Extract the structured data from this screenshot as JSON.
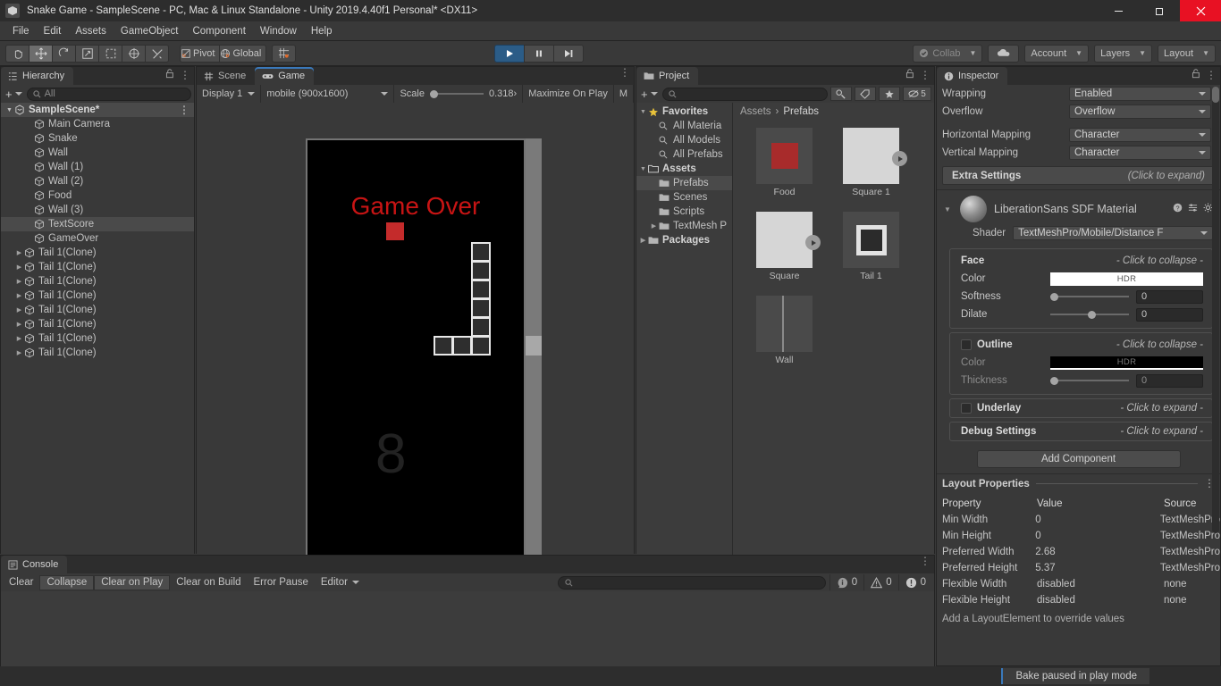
{
  "window": {
    "title": "Snake Game - SampleScene - PC, Mac & Linux Standalone - Unity 2019.4.40f1 Personal* <DX11>",
    "minimize": "minimize-icon",
    "maximize": "maximize-icon",
    "close": "close-icon"
  },
  "menubar": {
    "items": [
      "File",
      "Edit",
      "Assets",
      "GameObject",
      "Component",
      "Window",
      "Help"
    ]
  },
  "toolbar": {
    "tools": [
      {
        "name": "hand-tool",
        "icon": "hand-icon",
        "selected": false
      },
      {
        "name": "move-tool",
        "icon": "move-icon",
        "selected": true
      },
      {
        "name": "rotate-tool",
        "icon": "rotate-icon",
        "selected": false
      },
      {
        "name": "scale-tool",
        "icon": "scale-icon",
        "selected": false
      },
      {
        "name": "rect-tool",
        "icon": "rect-icon",
        "selected": false
      },
      {
        "name": "transform-tool",
        "icon": "transform-icon",
        "selected": false
      },
      {
        "name": "custom-tool",
        "icon": "wrench-icon",
        "selected": false
      }
    ],
    "pivot_label": "Pivot",
    "global_label": "Global",
    "grid_snap": "grid-snap-icon",
    "play": "play-icon",
    "pause": "pause-icon",
    "step": "step-icon",
    "collab_label": "Collab",
    "cloud_label": "cloud-icon",
    "account_label": "Account",
    "layers_label": "Layers",
    "layout_label": "Layout"
  },
  "hierarchy": {
    "tab_label": "Hierarchy",
    "search_placeholder": "All",
    "plus_label": "+",
    "items": [
      {
        "label": "SampleScene*",
        "depth": 0,
        "type": "scene",
        "expandable": true,
        "selected": false
      },
      {
        "label": "Main Camera",
        "depth": 2,
        "type": "go",
        "expandable": false,
        "selected": false
      },
      {
        "label": "Snake",
        "depth": 2,
        "type": "go",
        "expandable": false,
        "selected": false
      },
      {
        "label": "Wall",
        "depth": 2,
        "type": "go",
        "expandable": false,
        "selected": false
      },
      {
        "label": "Wall (1)",
        "depth": 2,
        "type": "go",
        "expandable": false,
        "selected": false
      },
      {
        "label": "Wall (2)",
        "depth": 2,
        "type": "go",
        "expandable": false,
        "selected": false
      },
      {
        "label": "Food",
        "depth": 2,
        "type": "go",
        "expandable": false,
        "selected": false
      },
      {
        "label": "Wall (3)",
        "depth": 2,
        "type": "go",
        "expandable": false,
        "selected": false
      },
      {
        "label": "TextScore",
        "depth": 2,
        "type": "go",
        "expandable": false,
        "selected": true
      },
      {
        "label": "GameOver",
        "depth": 2,
        "type": "go",
        "expandable": false,
        "selected": false
      },
      {
        "label": "Tail 1(Clone)",
        "depth": 1,
        "type": "go",
        "expandable": true,
        "selected": false
      },
      {
        "label": "Tail 1(Clone)",
        "depth": 1,
        "type": "go",
        "expandable": true,
        "selected": false
      },
      {
        "label": "Tail 1(Clone)",
        "depth": 1,
        "type": "go",
        "expandable": true,
        "selected": false
      },
      {
        "label": "Tail 1(Clone)",
        "depth": 1,
        "type": "go",
        "expandable": true,
        "selected": false
      },
      {
        "label": "Tail 1(Clone)",
        "depth": 1,
        "type": "go",
        "expandable": true,
        "selected": false
      },
      {
        "label": "Tail 1(Clone)",
        "depth": 1,
        "type": "go",
        "expandable": true,
        "selected": false
      },
      {
        "label": "Tail 1(Clone)",
        "depth": 1,
        "type": "go",
        "expandable": true,
        "selected": false
      },
      {
        "label": "Tail 1(Clone)",
        "depth": 1,
        "type": "go",
        "expandable": true,
        "selected": false
      }
    ]
  },
  "gameview": {
    "scene_tab": "Scene",
    "game_tab": "Game",
    "display": "Display 1",
    "resolution": "mobile (900x1600)",
    "scale_label": "Scale",
    "scale_value": "0.318›",
    "maximize_on_play": "Maximize On Play",
    "mute_partial": "M",
    "game_over_text": "Game Over",
    "score_text": "8",
    "colors": {
      "game_over": "#c81414",
      "food": "#c42b2b",
      "background": "#000000",
      "wall": "#747474",
      "segment_border": "#e8e8e8"
    }
  },
  "project": {
    "tab_label": "Project",
    "search_placeholder": "",
    "hidden_count": "5",
    "tree": [
      {
        "label": "Favorites",
        "depth": 0,
        "icon": "star-icon",
        "expandable": true,
        "selected": false
      },
      {
        "label": "All Materia",
        "depth": 1,
        "icon": "search-icon",
        "expandable": false,
        "selected": false
      },
      {
        "label": "All Models",
        "depth": 1,
        "icon": "search-icon",
        "expandable": false,
        "selected": false
      },
      {
        "label": "All Prefabs",
        "depth": 1,
        "icon": "search-icon",
        "expandable": false,
        "selected": false
      },
      {
        "label": "Assets",
        "depth": 0,
        "icon": "folder-open-icon",
        "expandable": true,
        "selected": false
      },
      {
        "label": "Prefabs",
        "depth": 1,
        "icon": "folder-icon",
        "expandable": false,
        "selected": true
      },
      {
        "label": "Scenes",
        "depth": 1,
        "icon": "folder-icon",
        "expandable": false,
        "selected": false
      },
      {
        "label": "Scripts",
        "depth": 1,
        "icon": "folder-icon",
        "expandable": false,
        "selected": false
      },
      {
        "label": "TextMesh P",
        "depth": 1,
        "icon": "folder-icon",
        "expandable": true,
        "selected": false
      },
      {
        "label": "Packages",
        "depth": 0,
        "icon": "folder-icon",
        "expandable": true,
        "selected": false
      }
    ],
    "breadcrumb": [
      "Assets",
      "Prefabs"
    ],
    "assets": [
      {
        "name": "Food",
        "kind": "sprite",
        "color": "#a82b2b",
        "has_prefab_arrow": false
      },
      {
        "name": "Square 1",
        "kind": "sprite",
        "color": "#d6d6d6",
        "has_prefab_arrow": true
      },
      {
        "name": "Square",
        "kind": "sprite",
        "color": "#d6d6d6",
        "has_prefab_arrow": true
      },
      {
        "name": "Tail 1",
        "kind": "outline",
        "color": "#e2e2e2",
        "has_prefab_arrow": false
      },
      {
        "name": "Wall",
        "kind": "wall",
        "color": "#4a4a4a",
        "has_prefab_arrow": false
      }
    ]
  },
  "inspector": {
    "tab_label": "Inspector",
    "text_settings": [
      {
        "label": "Wrapping",
        "value": "Enabled"
      },
      {
        "label": "Overflow",
        "value": "Overflow"
      },
      {
        "label": "Horizontal Mapping",
        "value": "Character"
      },
      {
        "label": "Vertical Mapping",
        "value": "Character"
      }
    ],
    "extra_settings": {
      "label": "Extra Settings",
      "hint": "(Click to expand)"
    },
    "material": {
      "title": "LiberationSans SDF Material",
      "help_icon": "help-icon",
      "preset_icon": "preset-icon",
      "gear_icon": "gear-icon",
      "shader_label": "Shader",
      "shader_value": "TextMeshPro/Mobile/Distance F"
    },
    "face": {
      "title": "Face",
      "hint": "- Click to collapse -",
      "color_label": "Color",
      "color_hdr": "HDR",
      "color_value": "#ffffff",
      "softness_label": "Softness",
      "softness_value": "0",
      "dilate_label": "Dilate",
      "dilate_value": "0"
    },
    "outline": {
      "title": "Outline",
      "hint": "- Click to collapse -",
      "enabled": false,
      "color_label": "Color",
      "color_hdr": "HDR",
      "color_value": "#000000",
      "thickness_label": "Thickness",
      "thickness_value": "0"
    },
    "underlay": {
      "title": "Underlay",
      "hint": "- Click to expand  -"
    },
    "debug": {
      "title": "Debug Settings",
      "hint": "- Click to expand  -"
    },
    "add_component": "Add Component",
    "layout_properties": {
      "title": "Layout Properties",
      "headers": [
        "Property",
        "Value",
        "Source"
      ],
      "rows": [
        [
          "Min Width",
          "0",
          "TextMeshPro"
        ],
        [
          "Min Height",
          "0",
          "TextMeshPro"
        ],
        [
          "Preferred Width",
          "2.68",
          "TextMeshPro"
        ],
        [
          "Preferred Height",
          "5.37",
          "TextMeshPro"
        ],
        [
          "Flexible Width",
          "disabled",
          "none"
        ],
        [
          "Flexible Height",
          "disabled",
          "none"
        ]
      ],
      "note": "Add a LayoutElement to override values"
    }
  },
  "console": {
    "tab_label": "Console",
    "buttons": [
      {
        "label": "Clear",
        "framed": false
      },
      {
        "label": "Collapse",
        "framed": true
      },
      {
        "label": "Clear on Play",
        "framed": true
      },
      {
        "label": "Clear on Build",
        "framed": false
      },
      {
        "label": "Error Pause",
        "framed": false
      },
      {
        "label": "Editor",
        "framed": false,
        "dropdown": true
      }
    ],
    "search_placeholder": "",
    "counters": [
      {
        "icon": "info-icon",
        "count": "0"
      },
      {
        "icon": "warning-icon",
        "count": "0"
      },
      {
        "icon": "error-icon",
        "count": "0"
      }
    ]
  },
  "statusbar": {
    "message": "Bake paused in play mode"
  }
}
